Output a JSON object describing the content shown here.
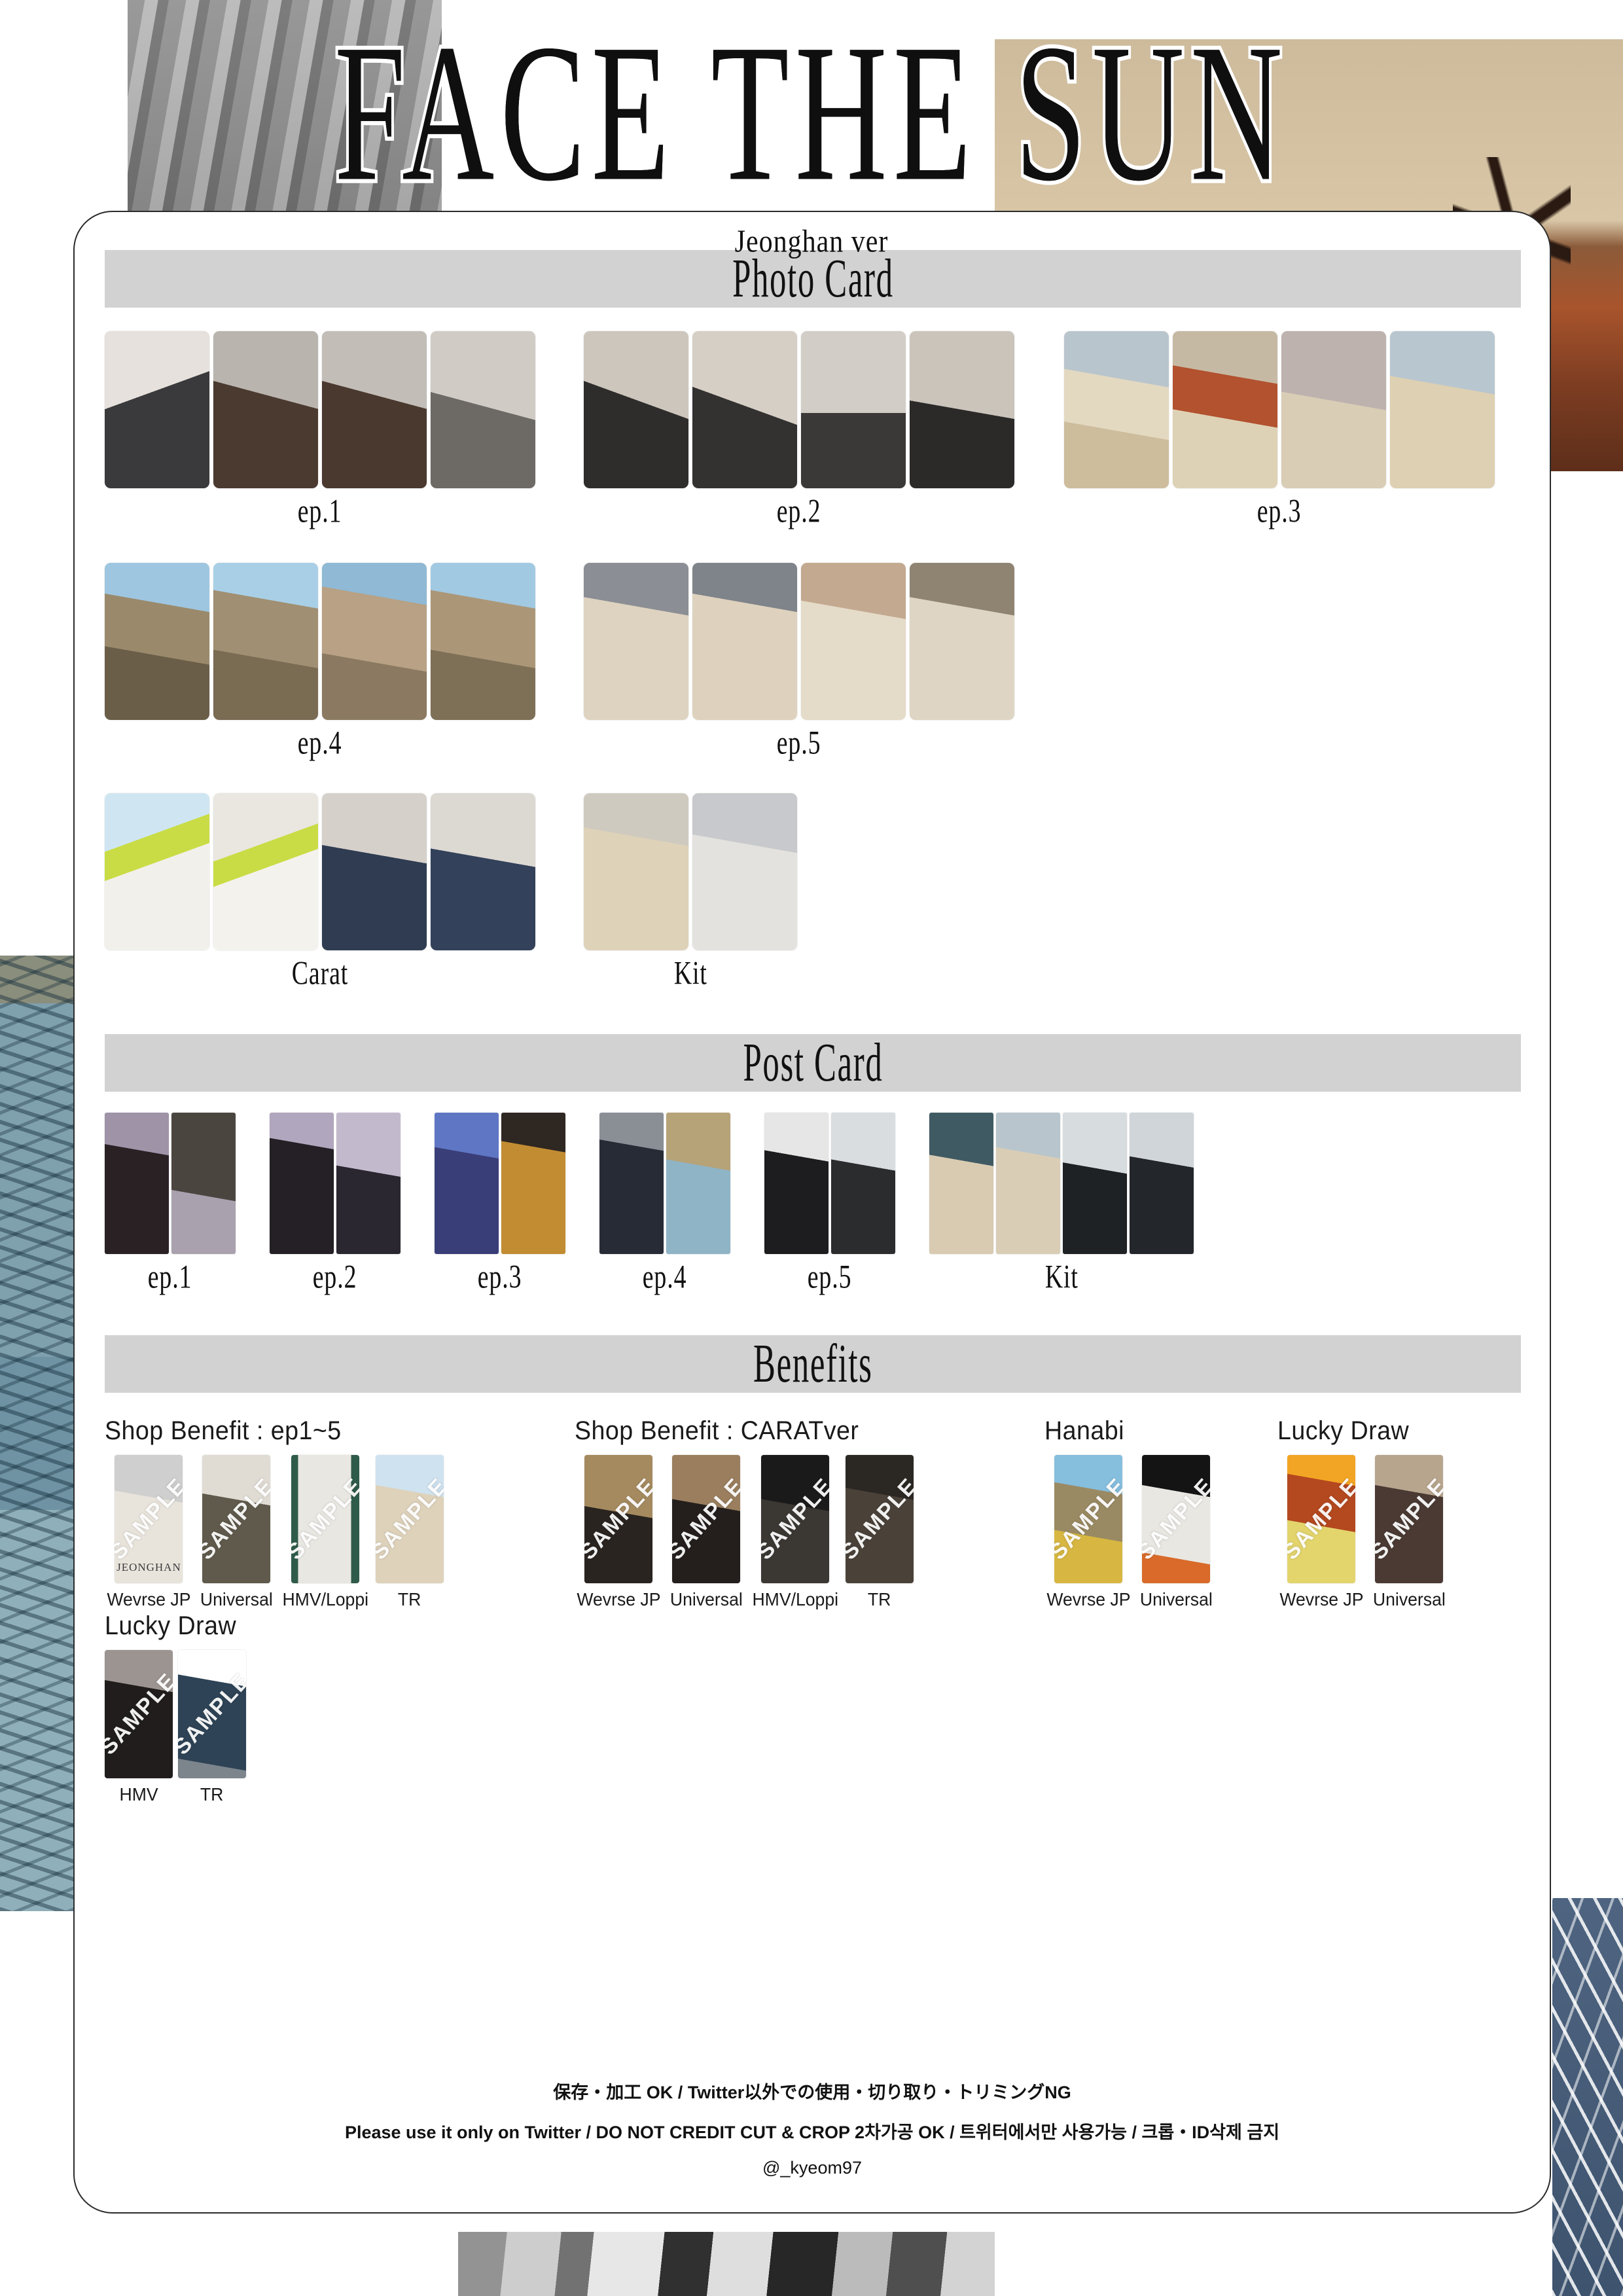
{
  "title": "FACE THE SUN",
  "subtitle": "Jeonghan ver",
  "sections": {
    "photo_card": "Photo Card",
    "post_card": "Post Card",
    "benefits": "Benefits"
  },
  "photo_card_groups": [
    {
      "label": "ep.1",
      "count": 4
    },
    {
      "label": "ep.2",
      "count": 4
    },
    {
      "label": "ep.3",
      "count": 4
    },
    {
      "label": "ep.4",
      "count": 4
    },
    {
      "label": "ep.5",
      "count": 4
    },
    {
      "label": "Carat",
      "count": 4
    },
    {
      "label": "Kit",
      "count": 2
    }
  ],
  "post_card_groups": [
    {
      "label": "ep.1",
      "count": 2
    },
    {
      "label": "ep.2",
      "count": 2
    },
    {
      "label": "ep.3",
      "count": 2
    },
    {
      "label": "ep.4",
      "count": 2
    },
    {
      "label": "ep.5",
      "count": 2
    },
    {
      "label": "Kit",
      "count": 4
    }
  ],
  "benefit_groups": [
    {
      "heading": "Shop Benefit : ep1~5",
      "items": [
        {
          "caption": "Wevrse JP",
          "watermark": "SAMPLE",
          "sub": "JEONGHAN"
        },
        {
          "caption": "Universal",
          "watermark": "SAMPLE"
        },
        {
          "caption": "HMV/Loppi",
          "watermark": "SAMPLE"
        },
        {
          "caption": "TR",
          "watermark": "SAMPLE"
        }
      ]
    },
    {
      "heading": "Shop Benefit : CARATver",
      "items": [
        {
          "caption": "Wevrse JP",
          "watermark": "SAMPLE"
        },
        {
          "caption": "Universal",
          "watermark": "SAMPLE"
        },
        {
          "caption": "HMV/Loppi",
          "watermark": "SAMPLE"
        },
        {
          "caption": "TR",
          "watermark": "SAMPLE"
        }
      ]
    },
    {
      "heading": "Hanabi",
      "items": [
        {
          "caption": "Wevrse JP",
          "watermark": "SAMPLE"
        },
        {
          "caption": "Universal",
          "watermark": "SAMPLE"
        }
      ]
    },
    {
      "heading": "Lucky Draw",
      "items": [
        {
          "caption": "Wevrse JP",
          "watermark": "SAMPLE"
        },
        {
          "caption": "Universal",
          "watermark": "SAMPLE"
        }
      ]
    },
    {
      "heading": "Lucky Draw",
      "items": [
        {
          "caption": "HMV",
          "watermark": "SAMPLE"
        },
        {
          "caption": "TR",
          "watermark": "SAMPLE"
        }
      ]
    }
  ],
  "footer": {
    "line1": "保存・加工 OK / Twitter以外での使用・切り取り・トリミングNG",
    "line2": "Please use it only on Twitter / DO NOT CREDIT CUT & CROP   2차가공 OK / 트위터에서만 사용가능 / 크롭・ID삭제 금지",
    "line3": "@_kyeom97"
  },
  "colors": {
    "band": "#d2d2d2",
    "sheet_border": "#2b2b2b",
    "text": "#111111"
  }
}
